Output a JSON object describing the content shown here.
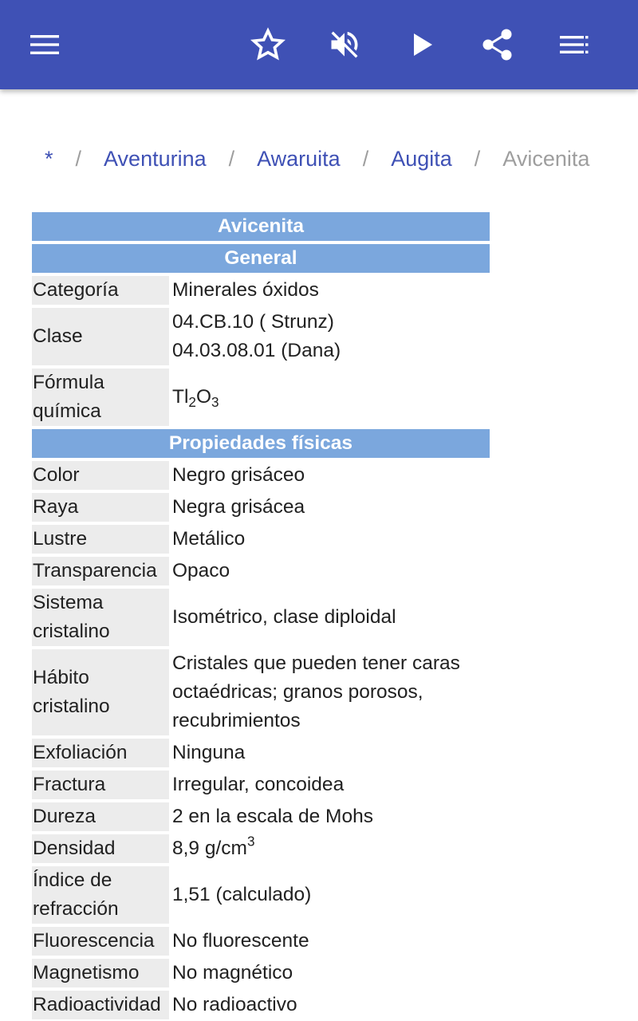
{
  "toolbar": {
    "menu_icon": "hamburger-menu-icon",
    "favorite_icon": "star-outline-icon",
    "mute_icon": "volume-off-icon",
    "play_icon": "play-icon",
    "share_icon": "share-icon",
    "contents_icon": "list-icon"
  },
  "colors": {
    "appbar": "#3f51b5",
    "link": "#3f51b5",
    "section_header": "#7ba7dd",
    "label_cell": "#ececec",
    "muted": "#9e9e9e"
  },
  "breadcrumb": {
    "items": [
      "*",
      "Aventurina",
      "Awaruita",
      "Augita"
    ],
    "separator": "/",
    "current": "Avicenita"
  },
  "infobox": {
    "title": "Avicenita",
    "general_header": "General",
    "categoria": {
      "label": "Categoría",
      "value": "Minerales óxidos"
    },
    "clase": {
      "label": "Clase",
      "value_line1": "04.CB.10 ( Strunz)",
      "value_line2": "04.03.08.01 (Dana)"
    },
    "formula": {
      "label": "Fórmula química",
      "el1": "Tl",
      "sub1": "2",
      "el2": "O",
      "sub2": "3"
    },
    "physical_header": "Propiedades físicas",
    "rows": [
      {
        "label": "Color",
        "value": "Negro grisáceo"
      },
      {
        "label": "Raya",
        "value": "Negra grisácea"
      },
      {
        "label": "Lustre",
        "value": "Metálico"
      },
      {
        "label": "Transparencia",
        "value": "Opaco"
      },
      {
        "label": "Sistema cristalino",
        "value": "Isométrico, clase diploidal"
      },
      {
        "label": "Hábito cristalino",
        "value": "Cristales que pueden tener caras octaédricas; granos porosos, recubrimientos"
      },
      {
        "label": "Exfoliación",
        "value": "Ninguna"
      },
      {
        "label": "Fractura",
        "value": "Irregular, concoidea"
      },
      {
        "label": "Dureza",
        "value": "2 en la escala de Mohs"
      }
    ],
    "densidad": {
      "label": "Densidad",
      "value": "8,9 g/cm",
      "sup": "3"
    },
    "rows2": [
      {
        "label": "Índice de refracción",
        "value": "1,51 (calculado)"
      },
      {
        "label": "Fluorescencia",
        "value": "No fluorescente"
      },
      {
        "label": "Magnetismo",
        "value": "No magnético"
      },
      {
        "label": "Radioactividad",
        "value": "No radioactivo"
      }
    ]
  }
}
